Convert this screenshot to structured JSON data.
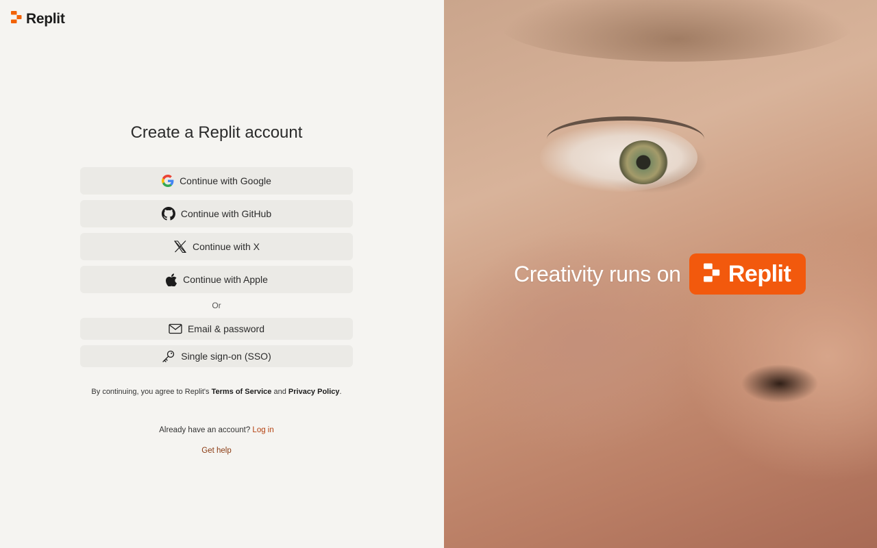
{
  "brand": {
    "name": "Replit",
    "logo_icon": "replit-logo-icon",
    "accent": "#f26207"
  },
  "signup": {
    "title": "Create a Replit account",
    "providers": [
      {
        "label": "Continue with Google",
        "icon": "google-icon"
      },
      {
        "label": "Continue with GitHub",
        "icon": "github-icon"
      },
      {
        "label": "Continue with X",
        "icon": "x-icon"
      },
      {
        "label": "Continue with Apple",
        "icon": "apple-icon"
      }
    ],
    "divider": "Or",
    "alternatives": [
      {
        "label": "Email & password",
        "icon": "mail-icon"
      },
      {
        "label": "Single sign-on (SSO)",
        "icon": "key-icon"
      }
    ],
    "legal": {
      "prefix": "By continuing, you agree to Replit's",
      "terms": "Terms of Service",
      "and": "and",
      "privacy": "Privacy Policy",
      "suffix": "."
    },
    "login": {
      "prompt": "Already have an account?",
      "link": "Log in"
    },
    "help": "Get help"
  },
  "hero": {
    "tagline": "Creativity runs on",
    "brand_pill": "Replit",
    "pill_color": "#f2590d"
  }
}
